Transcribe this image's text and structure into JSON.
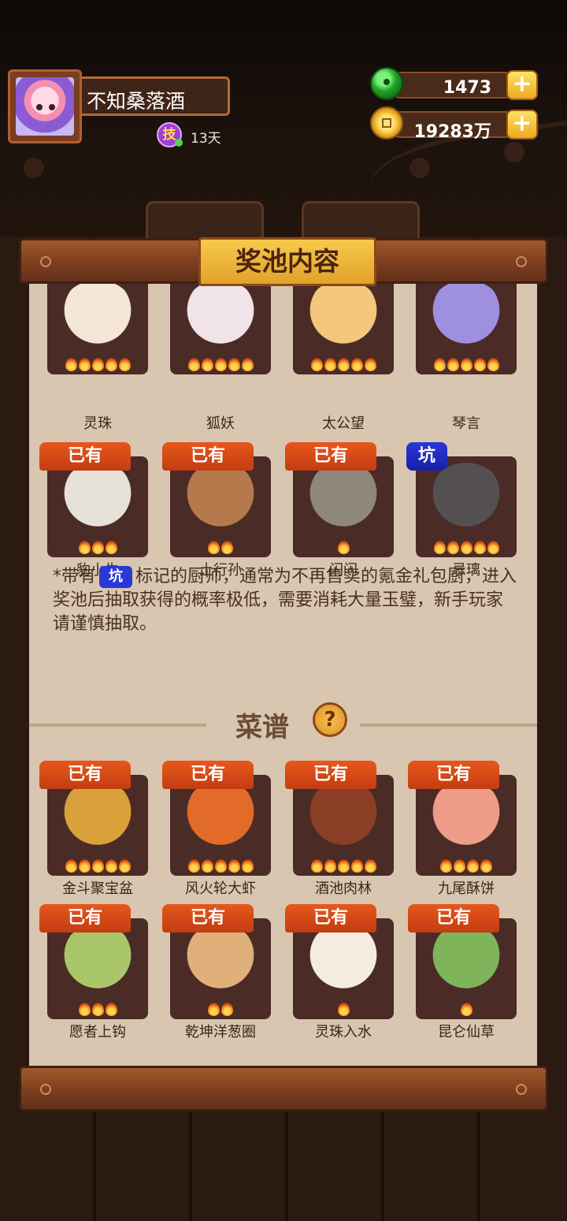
{
  "header": {
    "player_name": "不知桑落酒",
    "skill_icon_label": "技",
    "skill_days": "13天",
    "jade": "1473",
    "coins": "19283万"
  },
  "panel": {
    "title": "奖池内容",
    "owned_label": "已有",
    "pit_label": "坑",
    "chefs": [
      {
        "name": "灵珠",
        "flames": 5,
        "owned": true,
        "pit": false,
        "color": "#f4e6d6"
      },
      {
        "name": "狐妖",
        "flames": 5,
        "owned": true,
        "pit": false,
        "color": "#f1e4e8"
      },
      {
        "name": "太公望",
        "flames": 5,
        "owned": true,
        "pit": false,
        "color": "#f3c77d"
      },
      {
        "name": "琴言",
        "flames": 5,
        "owned": true,
        "pit": false,
        "color": "#9e8fe0"
      },
      {
        "name": "豹小生",
        "flames": 3,
        "owned": true,
        "pit": false,
        "color": "#e6e2d8"
      },
      {
        "name": "土行孙",
        "flames": 2,
        "owned": true,
        "pit": false,
        "color": "#b47a4c"
      },
      {
        "name": "闪闪",
        "flames": 1,
        "owned": true,
        "pit": false,
        "color": "#8f877a"
      },
      {
        "name": "忌璃",
        "flames": 5,
        "owned": false,
        "pit": true,
        "color": "#545052"
      }
    ],
    "note_prefix": "*带有",
    "note_text": "标记的厨师，通常为不再售卖的氪金礼包厨，进入奖池后抽取获得的概率极低，需要消耗大量玉璧，新手玩家请谨慎抽取。",
    "recipes_title": "菜谱",
    "help_icon": "?",
    "recipes": [
      {
        "name": "金斗聚宝盆",
        "flames": 5,
        "owned": true,
        "color": "#d9a13a"
      },
      {
        "name": "风火轮大虾",
        "flames": 5,
        "owned": true,
        "color": "#e36b2a"
      },
      {
        "name": "酒池肉林",
        "flames": 5,
        "owned": true,
        "color": "#8a3e26"
      },
      {
        "name": "九尾酥饼",
        "flames": 4,
        "owned": true,
        "color": "#f09c8a"
      },
      {
        "name": "愿者上钩",
        "flames": 3,
        "owned": true,
        "color": "#a9c76a"
      },
      {
        "name": "乾坤洋葱圈",
        "flames": 2,
        "owned": true,
        "color": "#e0b07a"
      },
      {
        "name": "灵珠入水",
        "flames": 1,
        "owned": true,
        "color": "#f4ecdf"
      },
      {
        "name": "昆仑仙草",
        "flames": 1,
        "owned": true,
        "color": "#7fb45a"
      }
    ]
  }
}
